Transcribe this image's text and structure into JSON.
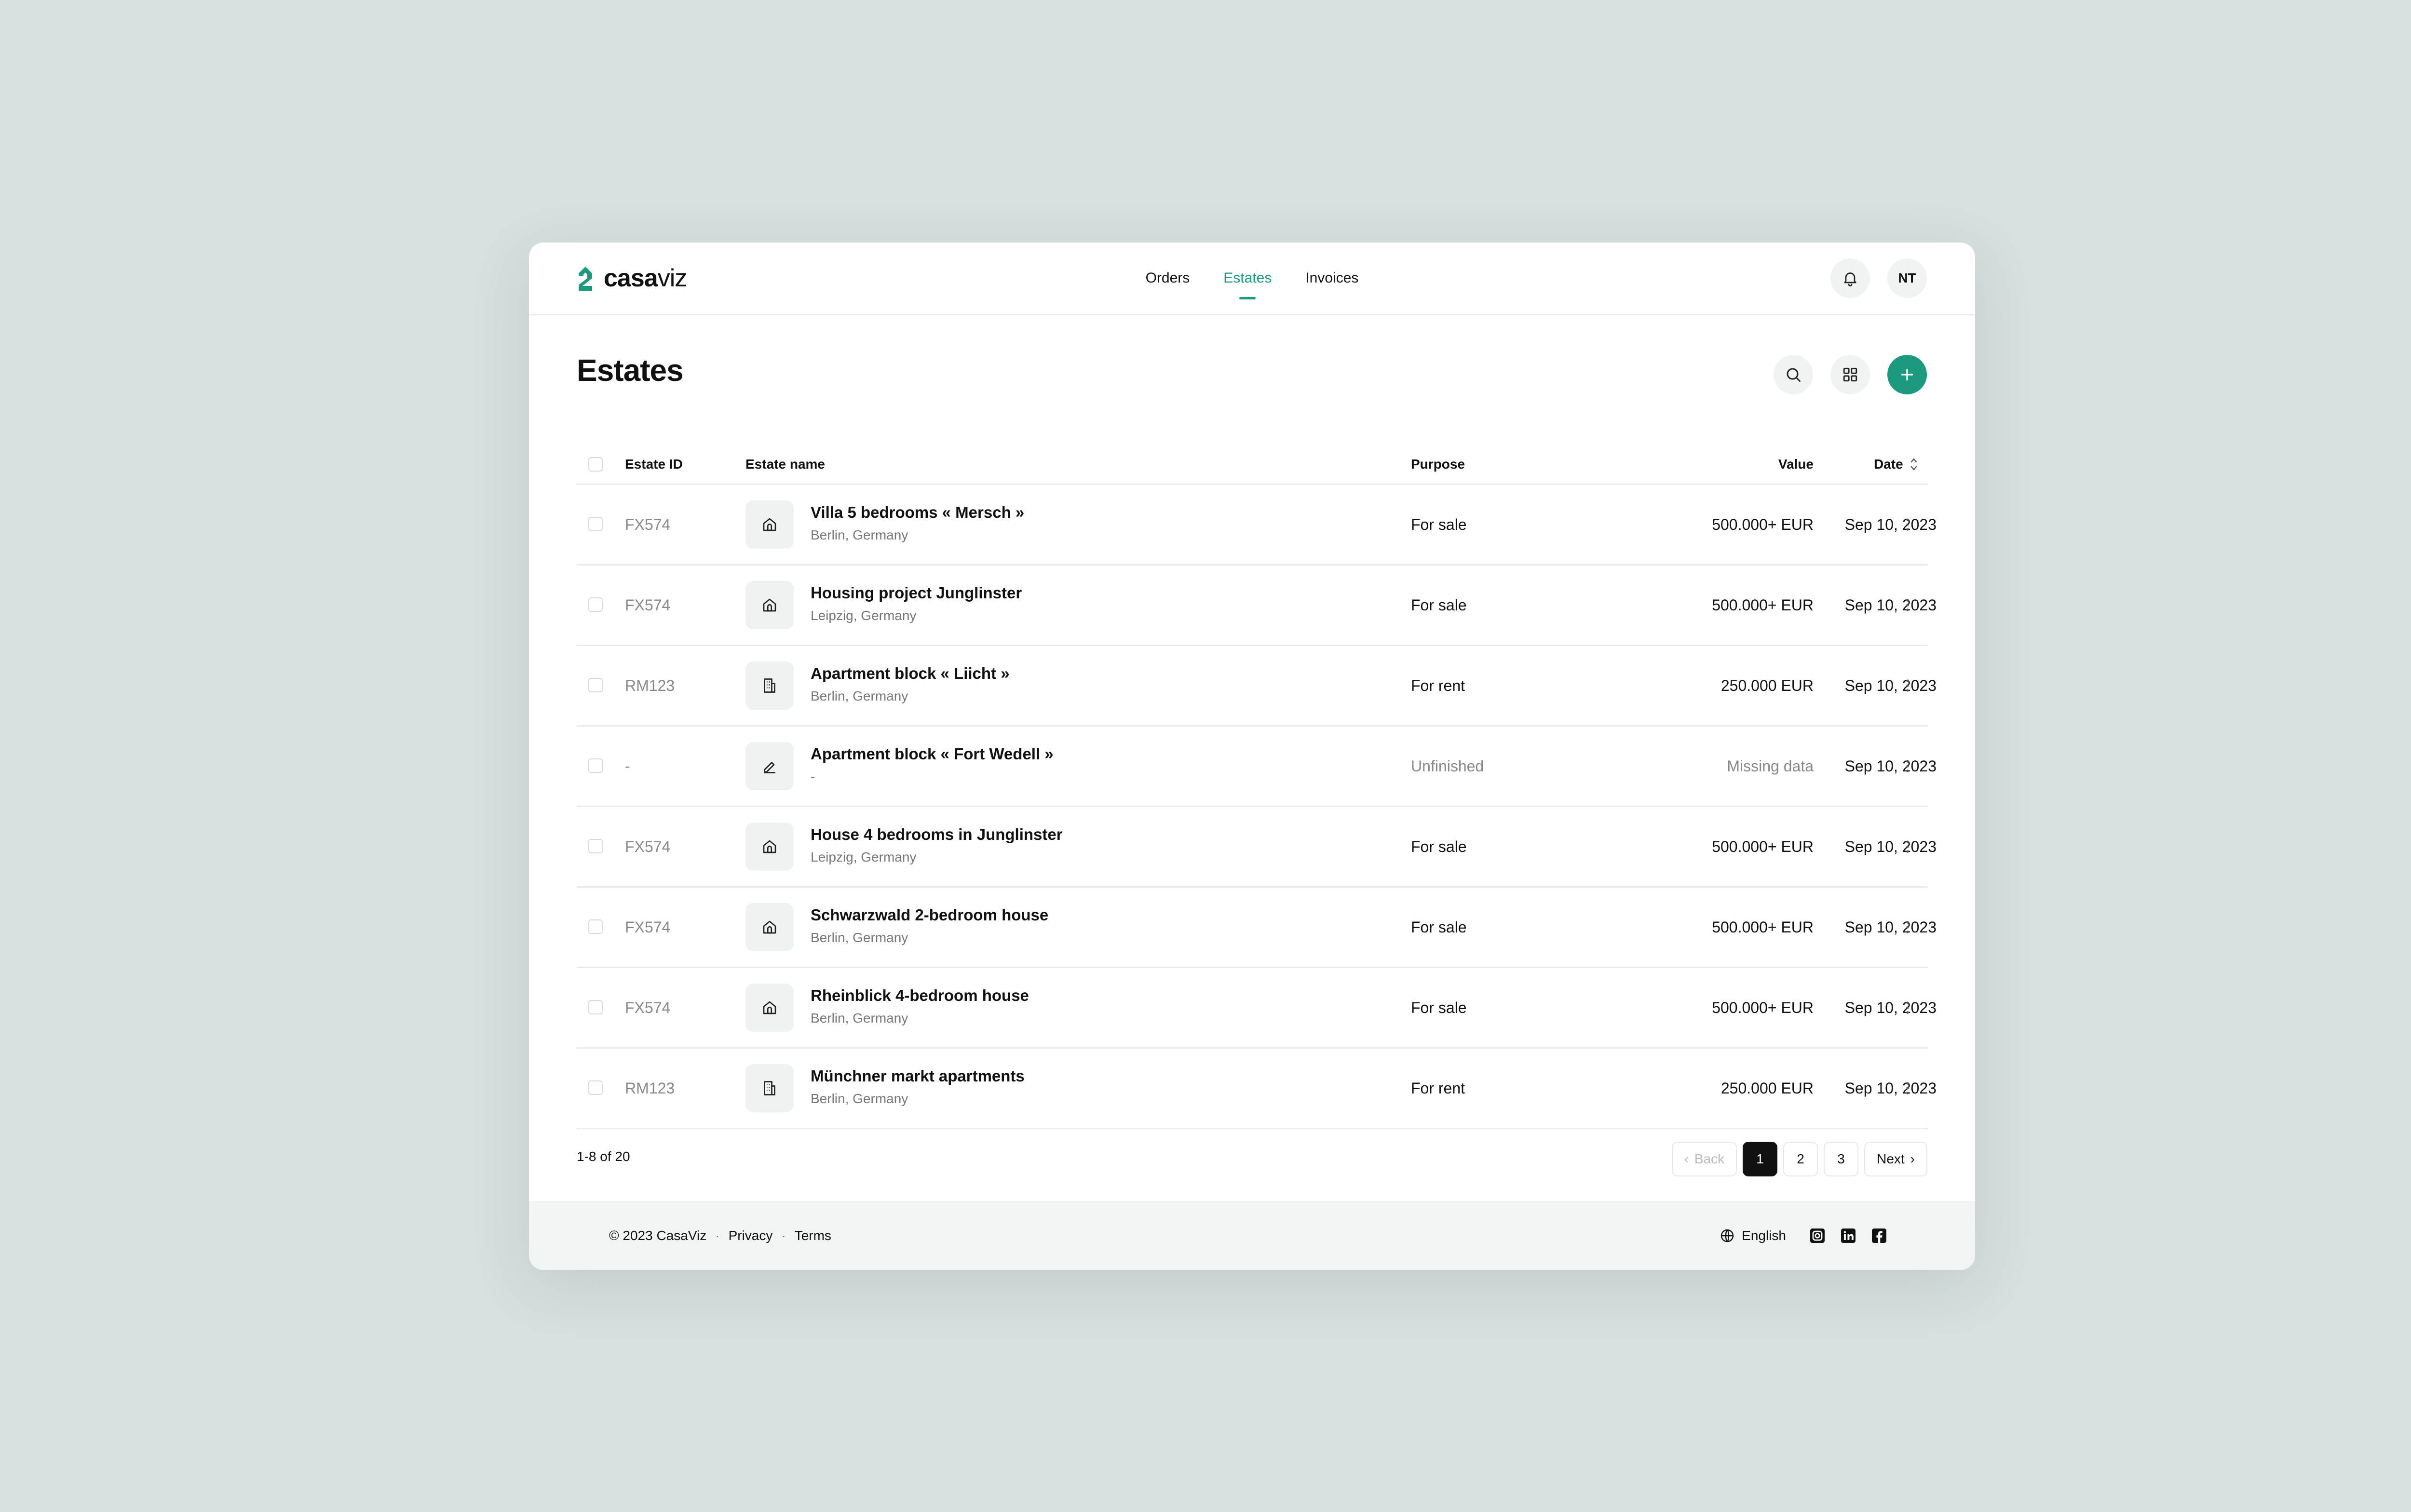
{
  "app": {
    "brand": "casa",
    "brand_suffix": "viz",
    "nav": [
      {
        "label": "Orders",
        "active": false
      },
      {
        "label": "Estates",
        "active": true
      },
      {
        "label": "Invoices",
        "active": false
      }
    ],
    "avatar_initials": "NT",
    "accent_color": "#1c9a7f"
  },
  "page": {
    "title": "Estates"
  },
  "table": {
    "columns": {
      "id": "Estate ID",
      "name": "Estate name",
      "purpose": "Purpose",
      "value": "Value",
      "date": "Date"
    },
    "rows": [
      {
        "id": "FX574",
        "icon": "house-icon",
        "name": "Villa 5 bedrooms « Mersch »",
        "location": "Berlin, Germany",
        "purpose": "For sale",
        "value": "500.000+ EUR",
        "date": "Sep 10, 2023"
      },
      {
        "id": "FX574",
        "icon": "house-icon",
        "name": "Housing project Junglinster",
        "location": "Leipzig, Germany",
        "purpose": "For sale",
        "value": "500.000+ EUR",
        "date": "Sep 10, 2023"
      },
      {
        "id": "RM123",
        "icon": "building-icon",
        "name": "Apartment block « Liicht »",
        "location": "Berlin, Germany",
        "purpose": "For rent",
        "value": "250.000 EUR",
        "date": "Sep 10, 2023"
      },
      {
        "id": "-",
        "icon": "pencil-icon",
        "name": "Apartment block « Fort Wedell »",
        "location": "-",
        "purpose": "Unfinished",
        "value": "Missing data",
        "date": "Sep 10, 2023"
      },
      {
        "id": "FX574",
        "icon": "house-icon",
        "name": "House 4 bedrooms in Junglinster",
        "location": "Leipzig, Germany",
        "purpose": "For sale",
        "value": "500.000+ EUR",
        "date": "Sep 10, 2023"
      },
      {
        "id": "FX574",
        "icon": "house-icon",
        "name": "Schwarzwald 2-bedroom house",
        "location": "Berlin, Germany",
        "purpose": "For sale",
        "value": "500.000+ EUR",
        "date": "Sep 10, 2023"
      },
      {
        "id": "FX574",
        "icon": "house-icon",
        "name": "Rheinblick 4-bedroom house",
        "location": "Berlin, Germany",
        "purpose": "For sale",
        "value": "500.000+ EUR",
        "date": "Sep 10, 2023"
      },
      {
        "id": "RM123",
        "icon": "building-icon",
        "name": "Münchner markt apartments",
        "location": "Berlin, Germany",
        "purpose": "For rent",
        "value": "250.000 EUR",
        "date": "Sep 10, 2023"
      }
    ]
  },
  "pagination": {
    "summary": "1-8 of 20",
    "back": "Back",
    "next": "Next",
    "pages": [
      "1",
      "2",
      "3"
    ],
    "current": "1"
  },
  "footer": {
    "copyright": "© 2023 CasaViz",
    "privacy": "Privacy",
    "terms": "Terms",
    "language": "English",
    "socials": [
      "instagram-icon",
      "linkedin-icon",
      "facebook-icon"
    ]
  }
}
